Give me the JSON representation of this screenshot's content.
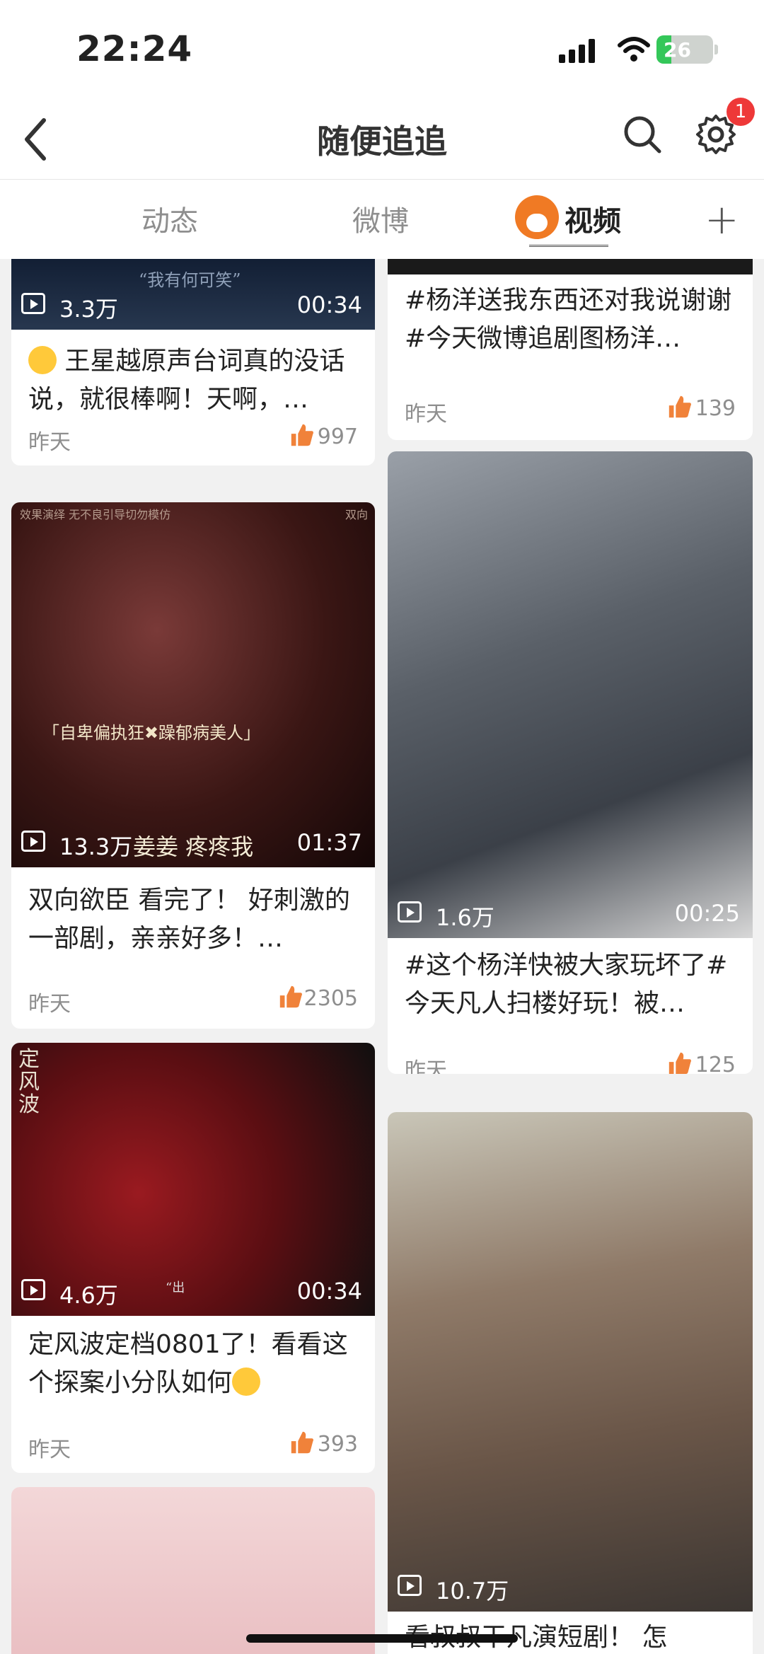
{
  "status_bar": {
    "time": "22:24",
    "battery": "26"
  },
  "nav": {
    "title": "随便追追",
    "badge": "1"
  },
  "tabs": [
    {
      "label": "动态"
    },
    {
      "label": "微博"
    },
    {
      "label": "视频"
    }
  ],
  "cards": [
    {
      "views": "3.3万",
      "duration": "00:34",
      "thumb_text": "“我有何可笑”",
      "caption": "王星越原声台词真的没话说，就很棒啊！天啊，…",
      "date": "昨天",
      "likes": "997"
    },
    {
      "caption": "#杨洋送我东西还对我说谢谢#今天微博追剧图杨洋…",
      "date": "昨天",
      "likes": "139"
    },
    {
      "views": "13.3万",
      "duration": "01:37",
      "thumb_top_text": "效果演绎 无不良引导切勿模仿",
      "thumb_top_right": "双向",
      "thumb_subtitle": "「自卑偏执狂✖躁郁病美人」",
      "thumb_overlay": "姜姜 疼疼我",
      "caption": "双向欲臣 看完了！ 好刺激的一部剧，亲亲好多！…",
      "date": "昨天",
      "likes": "2305"
    },
    {
      "views": "1.6万",
      "duration": "00:25",
      "caption": "#这个杨洋快被大家玩坏了#今天凡人扫楼好玩！被…",
      "date": "昨天",
      "likes": "125"
    },
    {
      "views": "4.6万",
      "duration": "00:34",
      "thumb_logo": "定风波",
      "thumb_small": "“出",
      "caption": "定风波定档0801了！看看这个探案小分队如何",
      "date": "昨天",
      "likes": "393"
    },
    {
      "views": "10.7万",
      "caption": "看叔叔干凡演短剧！ 怎"
    }
  ],
  "colors": {
    "accent_orange": "#f07a24",
    "like_orange": "#f0823a",
    "badge_red": "#ee3838"
  }
}
